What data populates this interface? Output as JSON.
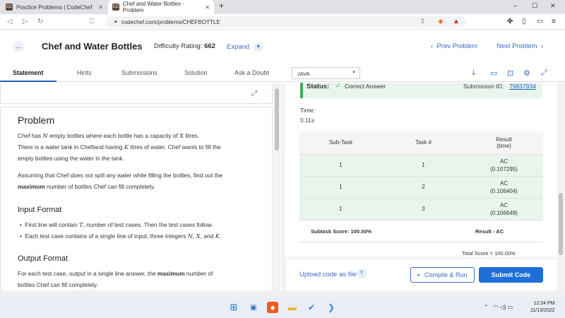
{
  "browser": {
    "tabs": [
      {
        "label": "Practice Problems | CodeChef",
        "favicon": "CC"
      },
      {
        "label": "Chef and Water Bottles - Problem",
        "favicon": "CC"
      }
    ],
    "url": "codechef.com/problems/CHEFBOTTLE",
    "window_controls": [
      "–",
      "☐",
      "✕"
    ]
  },
  "header": {
    "title": "Chef and Water Bottles",
    "difficulty_label": "Difficulty Rating:",
    "difficulty_value": "662",
    "expand_label": "Expand",
    "prev_label": "Prev Problem",
    "next_label": "Next Problem"
  },
  "problem_tabs": [
    {
      "label": "Statement",
      "active": true
    },
    {
      "label": "Hints"
    },
    {
      "label": "Submissions"
    },
    {
      "label": "Solution"
    },
    {
      "label": "Ask a Doubt"
    }
  ],
  "language": "JAVA",
  "statement": {
    "problem_heading": "Problem",
    "line1a": "Chef has ",
    "var_N": "N",
    "line1b": " empty bottles where each bottle has a capacity of ",
    "var_X": "X",
    "line1c": " litres.",
    "line2a": "There is a water tank in Chefland having ",
    "var_K": "K",
    "line2b": " litres of water. Chef wants to fill the",
    "line3": "empty bottles using the water in the tank.",
    "para2a": "Assuming that Chef does not spill any water while filling the bottles, find out the",
    "para2b_bold": "maximum",
    "para2c": " number of bottles Chef can fill completely.",
    "input_heading": "Input Format",
    "bullet1a": "First line will contain ",
    "var_T": "T",
    "bullet1b": ", number of test cases. Then the test cases follow.",
    "bullet2a": "Each test case contains of a single line of input, three integers ",
    "bullet2_vars": "N, X,",
    "bullet2b": " and ",
    "bullet2c": ".",
    "output_heading": "Output Format",
    "out1a": "For each test case, output in a single line answer, the ",
    "out1_bold": "maximum",
    "out1b": " number of",
    "out2": "bottles Chef can fill completely."
  },
  "result": {
    "status_label": "Status:",
    "status_value": "Correct Answer",
    "submission_label": "Submission ID:",
    "submission_id": "79837934",
    "time_label": "Time:",
    "time_value": "0.11s",
    "headers": [
      "Sub-Task",
      "Task #",
      "Result",
      "(time)"
    ],
    "rows": [
      {
        "subtask": "1",
        "task": "1",
        "result": "AC",
        "time": "(0.107295)"
      },
      {
        "subtask": "1",
        "task": "2",
        "result": "AC",
        "time": "(0.106404)"
      },
      {
        "subtask": "1",
        "task": "3",
        "result": "AC",
        "time": "(0.106648)"
      }
    ],
    "subtask_score": "Subtask Score: 100.00%",
    "result_summary": "Result - AC",
    "total_score": "Total Score = 100.00%"
  },
  "actions": {
    "upload_label": "Upload code as file",
    "compile_label": "Compile & Run",
    "submit_label": "Submit Code"
  },
  "taskbar": {
    "time": "12:24 PM",
    "date": "11/13/2022"
  },
  "colors": {
    "accent": "#1e6fd9",
    "success": "#3dae5a"
  }
}
